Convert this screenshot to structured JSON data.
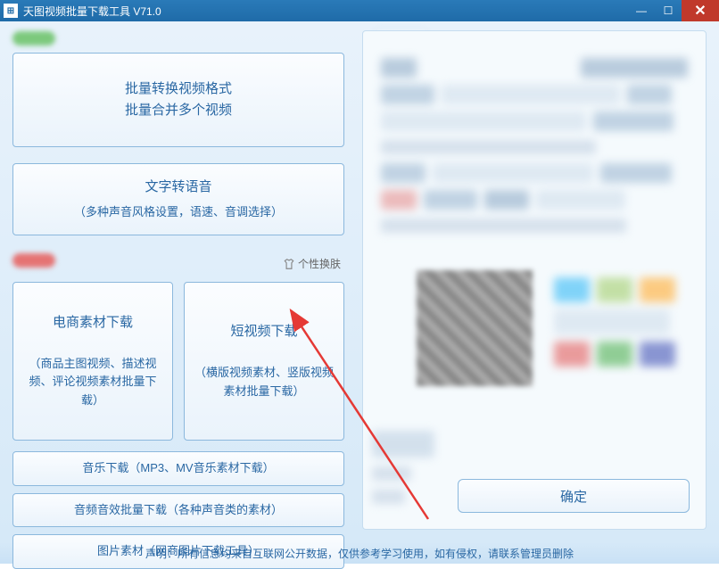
{
  "window": {
    "title": "天图视频批量下载工具 V71.0"
  },
  "left": {
    "convert": {
      "line1": "批量转换视频格式",
      "line2": "批量合并多个视频"
    },
    "tts": {
      "title": "文字转语音",
      "sub": "（多种声音风格设置，语速、音调选择）"
    },
    "skin_label": "个性换肤",
    "ecommerce": {
      "title": "电商素材下载",
      "sub": "（商品主图视频、描述视频、评论视频素材批量下载）"
    },
    "shortvideo": {
      "title": "短视频下载",
      "sub": "（横版视频素材、竖版视频素材批量下载）"
    },
    "music": "音乐下载（MP3、MV音乐素材下载）",
    "sfx": "音频音效批量下载（各种声音类的素材）",
    "image": "图片素材（网商图片下载工具）"
  },
  "right": {
    "confirm": "确定"
  },
  "footer": {
    "text": "声明：所有信息均来自互联网公开数据，仅供参考学习使用，如有侵权，请联系管理员删除"
  }
}
